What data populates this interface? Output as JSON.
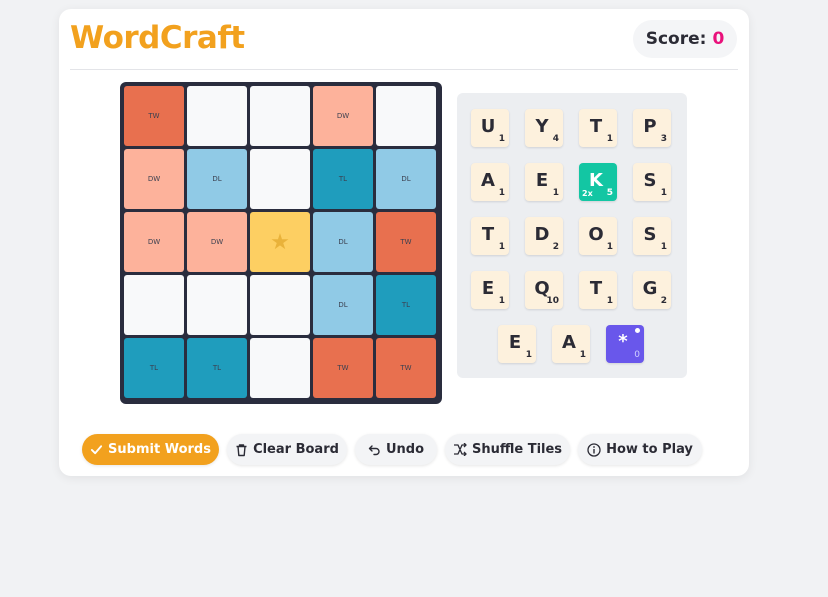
{
  "header": {
    "title": "WordCraft",
    "score_label": "Score:",
    "score_value": "0"
  },
  "colors": {
    "accent": "#f2a11e",
    "score": "#e9117b",
    "triple_word": "#e8704f",
    "double_word": "#fdb29b",
    "double_letter": "#90cae6",
    "triple_letter": "#1f9dbd",
    "center_star": "#fdcf62",
    "bonus_tile": "#13c6a3",
    "blank_tile": "#6957eb"
  },
  "board": {
    "rows": [
      [
        "TW",
        "",
        "",
        "DW",
        ""
      ],
      [
        "DW",
        "DL",
        "",
        "TL",
        "DL"
      ],
      [
        "DW",
        "DW",
        "★",
        "DL",
        "TW"
      ],
      [
        "",
        "",
        "",
        "DL",
        "TL"
      ],
      [
        "TL",
        "TL",
        "",
        "TW",
        "TW"
      ]
    ]
  },
  "rack": {
    "tiles": [
      {
        "letter": "U",
        "points": "1"
      },
      {
        "letter": "Y",
        "points": "4"
      },
      {
        "letter": "T",
        "points": "1"
      },
      {
        "letter": "P",
        "points": "3"
      },
      {
        "letter": "A",
        "points": "1"
      },
      {
        "letter": "E",
        "points": "1"
      },
      {
        "letter": "K",
        "points": "5",
        "multiplier": "2x",
        "bonus": true
      },
      {
        "letter": "S",
        "points": "1"
      },
      {
        "letter": "T",
        "points": "1"
      },
      {
        "letter": "D",
        "points": "2"
      },
      {
        "letter": "O",
        "points": "1"
      },
      {
        "letter": "S",
        "points": "1"
      },
      {
        "letter": "E",
        "points": "1"
      },
      {
        "letter": "Q",
        "points": "10"
      },
      {
        "letter": "T",
        "points": "1"
      },
      {
        "letter": "G",
        "points": "2"
      },
      {
        "letter": "E",
        "points": "1"
      },
      {
        "letter": "A",
        "points": "1"
      },
      {
        "letter": "*",
        "points": "0",
        "blank": true
      }
    ]
  },
  "actions": {
    "submit": "Submit Words",
    "clear": "Clear Board",
    "undo": "Undo",
    "shuffle": "Shuffle Tiles",
    "help": "How to Play"
  },
  "icons": {
    "submit": "check-icon",
    "clear": "trash-icon",
    "undo": "undo-icon",
    "shuffle": "shuffle-icon",
    "help": "info-icon",
    "center": "star-icon"
  }
}
